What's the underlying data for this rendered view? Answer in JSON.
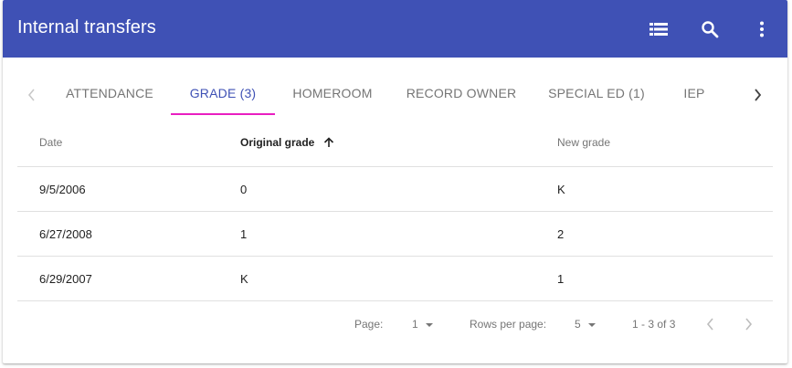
{
  "appbar": {
    "title": "Internal transfers",
    "icons": [
      "view-list-icon",
      "search-icon",
      "more-vert-icon"
    ],
    "color": "#3f51b5"
  },
  "tabs": {
    "items": [
      {
        "label": "ATTENDANCE"
      },
      {
        "label": "GRADE (3)"
      },
      {
        "label": "HOMEROOM"
      },
      {
        "label": "RECORD OWNER"
      },
      {
        "label": "SPECIAL ED (1)"
      },
      {
        "label": "IEP"
      }
    ],
    "active_index": 1,
    "indicator_color": "#e91ec1"
  },
  "table": {
    "headers": {
      "date": "Date",
      "original": "Original grade",
      "new": "New grade"
    },
    "sort": {
      "column": "Original grade",
      "direction": "ascending"
    },
    "rows": [
      {
        "date": "9/5/2006",
        "original": "0",
        "new": "K"
      },
      {
        "date": "6/27/2008",
        "original": "1",
        "new": "2"
      },
      {
        "date": "6/29/2007",
        "original": "K",
        "new": "1"
      }
    ]
  },
  "pagination": {
    "page_label": "Page:",
    "page_value": "1",
    "rows_label": "Rows per page:",
    "rows_value": "5",
    "range": "1 - 3 of 3"
  }
}
